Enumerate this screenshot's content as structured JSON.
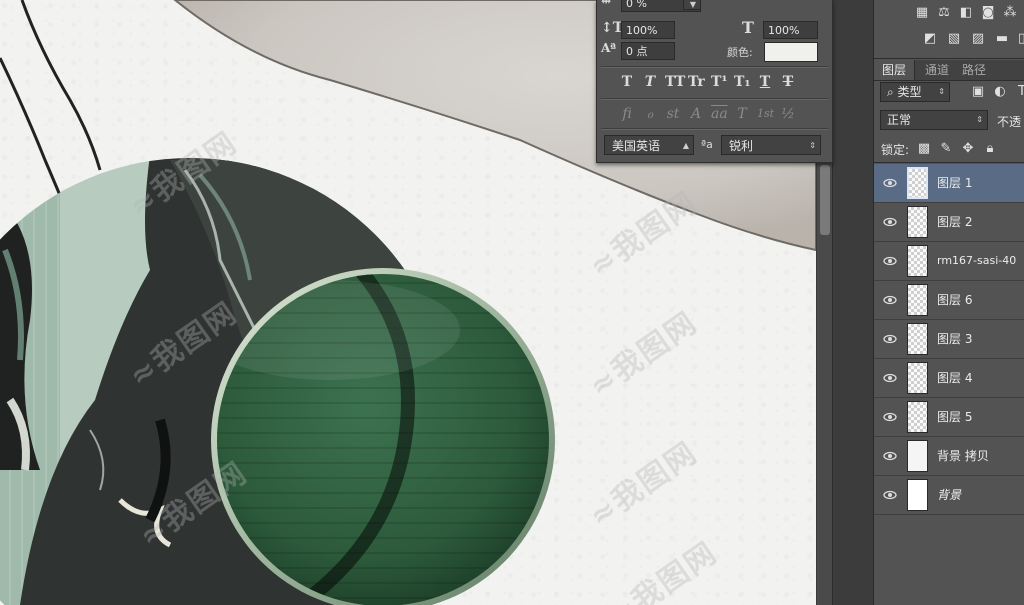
{
  "character_panel": {
    "tracking_value": "0 %",
    "vertical_scale": "100%",
    "horizontal_scale": "100%",
    "baseline_shift": "0 点",
    "color_label": "颜色:",
    "color_value": "#f0f0ec",
    "style_buttons": [
      "T",
      "T",
      "TT",
      "Tr",
      "T¹",
      "T₁",
      "T",
      "T"
    ],
    "opentype_buttons": [
      "fi",
      "ℴ",
      "st",
      "A",
      "aa",
      "T",
      "1st",
      "½"
    ],
    "language": "美国英语",
    "aa_label": "ªa",
    "antialias": "锐利"
  },
  "layers_panel": {
    "tabs": [
      {
        "label": "图层",
        "active": true
      },
      {
        "label": "通道",
        "active": false
      },
      {
        "label": "路径",
        "active": false
      }
    ],
    "filter_kind": "类型",
    "blend_mode": "正常",
    "opacity_label": "不透",
    "lock_label": "锁定:",
    "layers": [
      {
        "name": "图层 1",
        "selected": true,
        "thumb": "checker"
      },
      {
        "name": "图层 2",
        "selected": false,
        "thumb": "checker"
      },
      {
        "name": "rm167-sasi-40",
        "selected": false,
        "thumb": "checker"
      },
      {
        "name": "图层 6",
        "selected": false,
        "thumb": "checker"
      },
      {
        "name": "图层 3",
        "selected": false,
        "thumb": "checker"
      },
      {
        "name": "图层 4",
        "selected": false,
        "thumb": "checker"
      },
      {
        "name": "图层 5",
        "selected": false,
        "thumb": "checker"
      },
      {
        "name": "背景 拷贝",
        "selected": false,
        "thumb": "solid"
      },
      {
        "name": "背景",
        "selected": false,
        "thumb": "white",
        "italic": true
      }
    ]
  },
  "colors": {
    "panel_bg": "#535353",
    "selected_layer": "#5a6b85",
    "canvas_bg": "#f2f2f0",
    "green_circle": "#2f5e3e"
  }
}
